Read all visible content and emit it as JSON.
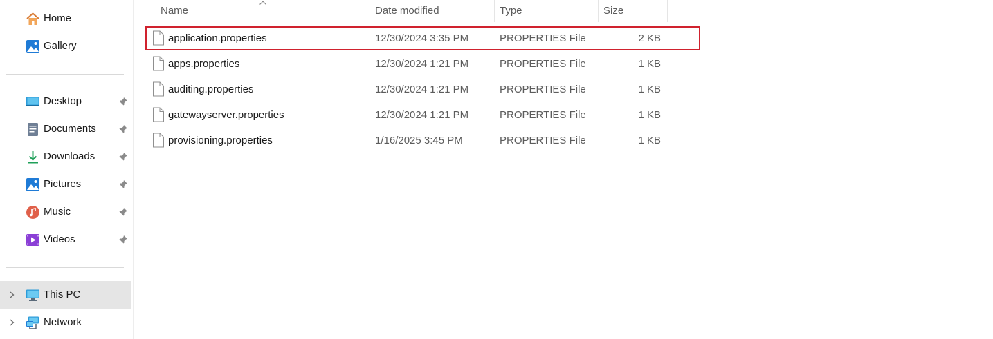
{
  "sidebar": {
    "quick_items": [
      {
        "label": "Home",
        "icon": "home-icon"
      },
      {
        "label": "Gallery",
        "icon": "gallery-icon"
      }
    ],
    "pinned_items": [
      {
        "label": "Desktop",
        "icon": "desktop-icon",
        "pinned": true
      },
      {
        "label": "Documents",
        "icon": "documents-icon",
        "pinned": true
      },
      {
        "label": "Downloads",
        "icon": "downloads-icon",
        "pinned": true
      },
      {
        "label": "Pictures",
        "icon": "pictures-icon",
        "pinned": true
      },
      {
        "label": "Music",
        "icon": "music-icon",
        "pinned": true
      },
      {
        "label": "Videos",
        "icon": "videos-icon",
        "pinned": true
      }
    ],
    "locations": [
      {
        "label": "This PC",
        "icon": "this-pc-icon",
        "selected": true
      },
      {
        "label": "Network",
        "icon": "network-icon",
        "selected": false
      }
    ]
  },
  "filelist": {
    "columns": {
      "name": "Name",
      "date": "Date modified",
      "type": "Type",
      "size": "Size"
    },
    "sorted_by": "name",
    "files": [
      {
        "name": "application.properties",
        "date": "12/30/2024 3:35 PM",
        "type": "PROPERTIES File",
        "size": "2 KB",
        "highlighted": true
      },
      {
        "name": "apps.properties",
        "date": "12/30/2024 1:21 PM",
        "type": "PROPERTIES File",
        "size": "1 KB",
        "highlighted": false
      },
      {
        "name": "auditing.properties",
        "date": "12/30/2024 1:21 PM",
        "type": "PROPERTIES File",
        "size": "1 KB",
        "highlighted": false
      },
      {
        "name": "gatewayserver.properties",
        "date": "12/30/2024 1:21 PM",
        "type": "PROPERTIES File",
        "size": "1 KB",
        "highlighted": false
      },
      {
        "name": "provisioning.properties",
        "date": "1/16/2025 3:45 PM",
        "type": "PROPERTIES File",
        "size": "1 KB",
        "highlighted": false
      }
    ]
  },
  "colors": {
    "highlight_outline": "#d0222e",
    "selected_nav_bg": "#e5e5e5",
    "secondary_text": "#5c5c5c"
  }
}
